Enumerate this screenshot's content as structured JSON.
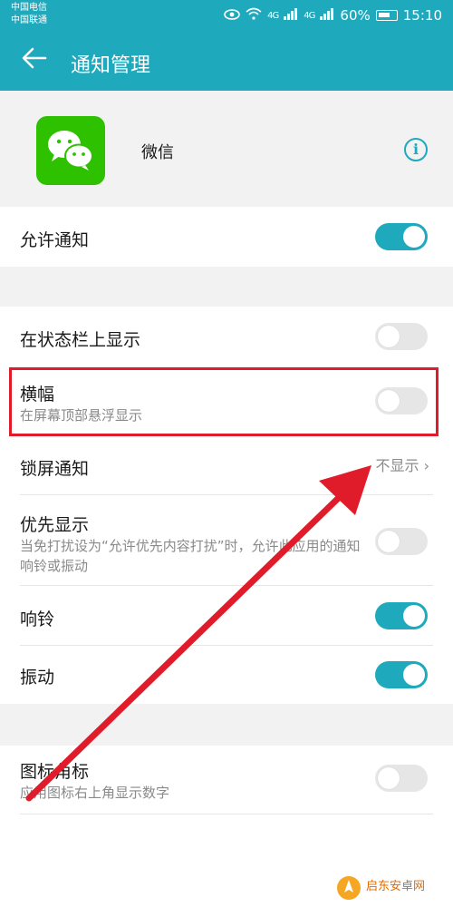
{
  "status_bar": {
    "carrier_1": "中国电信",
    "carrier_2": "中国联通",
    "signal_label": "4G",
    "battery": "60%",
    "time": "15:10"
  },
  "app_bar": {
    "title": "通知管理"
  },
  "app": {
    "name": "微信"
  },
  "settings": {
    "allow_notifications": {
      "label": "允许通知",
      "enabled": true
    },
    "status_bar_display": {
      "label": "在状态栏上显示",
      "enabled": false
    },
    "banner": {
      "label": "横幅",
      "subtitle": "在屏幕顶部悬浮显示",
      "enabled": false
    },
    "lock_screen": {
      "label": "锁屏通知",
      "value": "不显示"
    },
    "priority": {
      "label": "优先显示",
      "subtitle": "当免打扰设为“允许优先内容打扰”时，允许此应用的通知响铃或振动",
      "enabled": false
    },
    "ring": {
      "label": "响铃",
      "enabled": true
    },
    "vibrate": {
      "label": "振动",
      "enabled": true
    },
    "badge": {
      "label": "图标角标",
      "subtitle": "应用图标右上角显示数字",
      "enabled": false
    }
  },
  "watermark": {
    "text": "启东安卓网"
  },
  "colors": {
    "accent": "#1fa9bd",
    "annotation": "#e01b2a",
    "wechat": "#2dc100"
  }
}
